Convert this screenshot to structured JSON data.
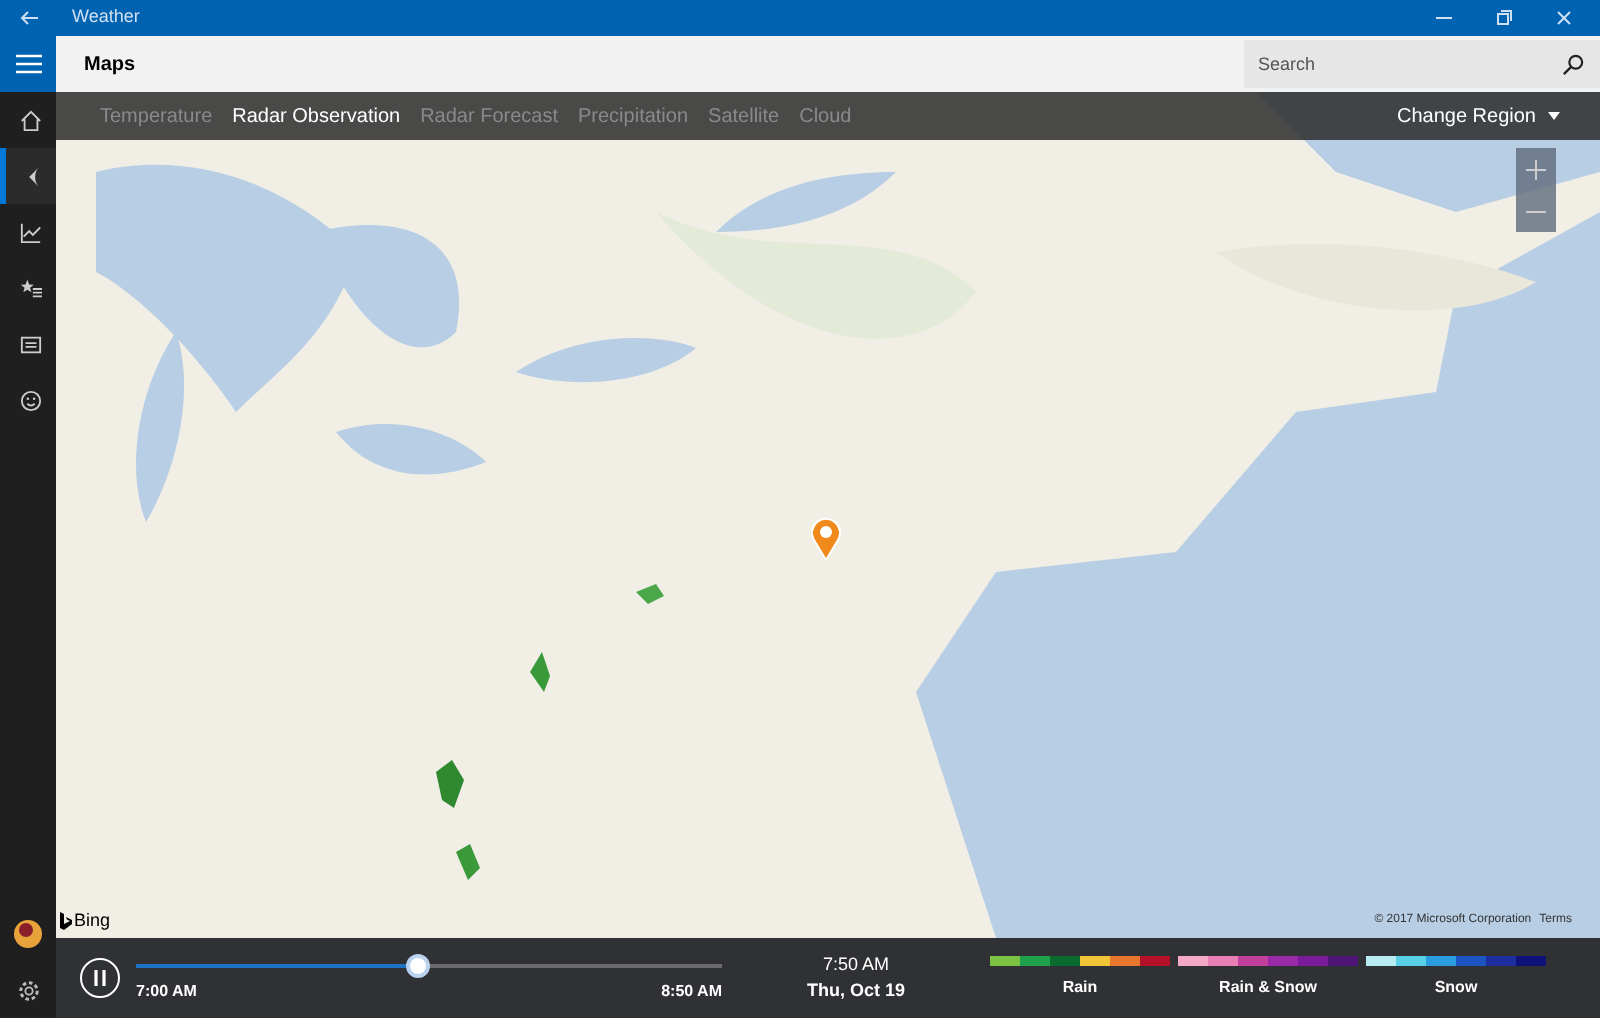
{
  "window": {
    "title": "Weather"
  },
  "sidebar": {
    "items": [
      {
        "kind": "home",
        "selected": false
      },
      {
        "kind": "maps",
        "selected": true
      },
      {
        "kind": "history",
        "selected": false
      },
      {
        "kind": "places",
        "selected": false
      },
      {
        "kind": "news",
        "selected": false
      },
      {
        "kind": "feedback",
        "selected": false
      }
    ]
  },
  "header": {
    "title": "Maps",
    "search": {
      "placeholder": "Search"
    }
  },
  "tabs": [
    {
      "label": "Temperature",
      "selected": false
    },
    {
      "label": "Radar Observation",
      "selected": true
    },
    {
      "label": "Radar Forecast",
      "selected": false
    },
    {
      "label": "Precipitation",
      "selected": false
    },
    {
      "label": "Satellite",
      "selected": false
    },
    {
      "label": "Cloud",
      "selected": false
    }
  ],
  "region_button": "Change Region",
  "map": {
    "attribution": "Bing",
    "copyright": "© 2017 Microsoft Corporation",
    "terms": "Terms"
  },
  "timeline": {
    "start": "7:00 AM",
    "end": "8:50 AM",
    "level": 0.48,
    "time": "7:50 AM",
    "date": "Thu, Oct 19"
  },
  "legend": [
    {
      "label": "Rain",
      "colors": [
        {
          "color": "#7cc142"
        },
        {
          "color": "#1fa04a"
        },
        {
          "color": "#0a6b2e"
        },
        {
          "color": "#f2c438"
        },
        {
          "color": "#e8762c"
        },
        {
          "color": "#b5122a"
        }
      ]
    },
    {
      "label": "Rain & Snow",
      "colors": [
        {
          "color": "#f5a9c8"
        },
        {
          "color": "#e77fb5"
        },
        {
          "color": "#c2409c"
        },
        {
          "color": "#9a2aa8"
        },
        {
          "color": "#7a1c9a"
        },
        {
          "color": "#4f1478"
        }
      ]
    },
    {
      "label": "Snow",
      "colors": [
        {
          "color": "#b7ecf2"
        },
        {
          "color": "#5ad0e8"
        },
        {
          "color": "#2a9de0"
        },
        {
          "color": "#1c55c2"
        },
        {
          "color": "#1d2f9e"
        },
        {
          "color": "#0e117a"
        }
      ]
    }
  ]
}
